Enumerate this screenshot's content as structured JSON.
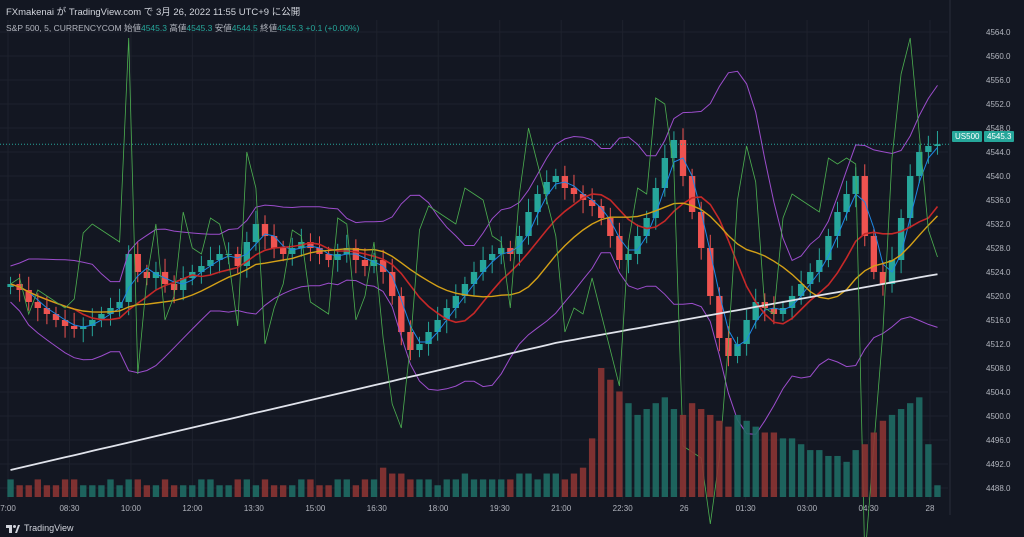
{
  "header": {
    "publisher": "FXmakenai が TradingView.com で 3月 26, 2022 11:55 UTC+9 に公開"
  },
  "legend": {
    "symbol": "S&P 500, 5, CURRENCYCOM",
    "open_label": "始値",
    "open": "4545.3",
    "high_label": "高値",
    "high": "4545.3",
    "low_label": "安値",
    "low": "4544.5",
    "close_label": "終値",
    "close": "4545.3",
    "change": "+0.1 (+0.00%)"
  },
  "price_tags": {
    "symbol_tag": "US500",
    "last_price": "4545.3"
  },
  "footer": {
    "brand": "TradingView"
  },
  "colors": {
    "background": "#131722",
    "up": "#26a69a",
    "down": "#ef5350",
    "bollinger": "#9c4dcc",
    "sma200": "#e0e3eb",
    "ma_slow": "#d4a017",
    "ma_mid": "#c62828",
    "ma_fast": "#1e88e5",
    "rsi_line": "#4caf50"
  },
  "chart_data": {
    "type": "candlestick",
    "title": "",
    "y_ticks": [
      "4564.0",
      "4560.0",
      "4556.0",
      "4552.0",
      "4548.0",
      "4544.0",
      "4540.0",
      "4536.0",
      "4532.0",
      "4528.0",
      "4524.0",
      "4520.0",
      "4516.0",
      "4512.0",
      "4508.0",
      "4504.0",
      "4500.0",
      "4496.0",
      "4492.0",
      "4488.0"
    ],
    "ylim": [
      4486,
      4566
    ],
    "x_ticks": [
      "7:00",
      "08:30",
      "10:00",
      "12:00",
      "13:30",
      "15:00",
      "16:30",
      "18:00",
      "19:30",
      "21:00",
      "22:30",
      "26",
      "01:30",
      "03:00",
      "04:30",
      "28"
    ],
    "close_path": [
      4522,
      4521,
      4519,
      4518,
      4517,
      4516,
      4515,
      4514.5,
      4515,
      4516,
      4517,
      4518,
      4519,
      4527,
      4524,
      4523,
      4524,
      4522,
      4521,
      4523,
      4524,
      4525,
      4526,
      4527,
      4527,
      4525,
      4529,
      4532,
      4530,
      4528,
      4527,
      4528,
      4529,
      4528,
      4527,
      4526,
      4527,
      4528,
      4526,
      4525,
      4526,
      4524,
      4520,
      4514,
      4511,
      4512,
      4514,
      4516,
      4518,
      4520,
      4522,
      4524,
      4526,
      4527,
      4528,
      4527,
      4530,
      4534,
      4537,
      4539,
      4540,
      4538,
      4537,
      4536,
      4535,
      4533,
      4530,
      4526,
      4527,
      4530,
      4533,
      4538,
      4543,
      4546,
      4540,
      4534,
      4528,
      4520,
      4513,
      4510,
      4512,
      4516,
      4519,
      4518,
      4517,
      4518,
      4520,
      4522,
      4524,
      4526,
      4530,
      4534,
      4537,
      4540,
      4530,
      4524,
      4522,
      4526,
      4533,
      4540,
      4544,
      4545,
      4545.3
    ],
    "volume": [
      3,
      2,
      2,
      3,
      2,
      2,
      3,
      3,
      2,
      2,
      2,
      3,
      2,
      3,
      3,
      2,
      2,
      3,
      2,
      2,
      2,
      3,
      3,
      2,
      2,
      3,
      3,
      2,
      3,
      2,
      2,
      2,
      3,
      3,
      2,
      2,
      3,
      3,
      2,
      3,
      3,
      5,
      4,
      4,
      3,
      3,
      3,
      2,
      3,
      3,
      4,
      3,
      3,
      3,
      3,
      3,
      4,
      4,
      3,
      4,
      4,
      3,
      4,
      5,
      10,
      22,
      20,
      18,
      16,
      14,
      15,
      16,
      17,
      15,
      14,
      16,
      15,
      14,
      13,
      12,
      14,
      13,
      12,
      11,
      11,
      10,
      10,
      9,
      8,
      8,
      7,
      7,
      6,
      8,
      9,
      11,
      13,
      14,
      15,
      16,
      17,
      9,
      2,
      2,
      2,
      2,
      2,
      3
    ]
  }
}
